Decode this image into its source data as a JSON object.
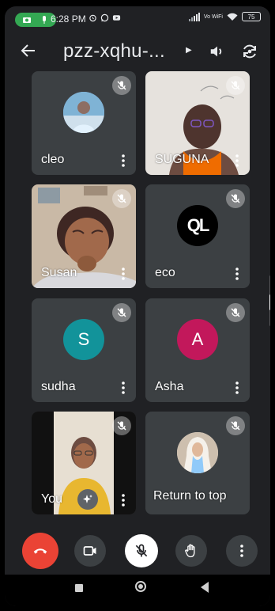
{
  "status_bar": {
    "time": "6:28 PM",
    "network": "Vo WiFi",
    "battery": "75"
  },
  "header": {
    "meeting_code": "pzz-xqhu-..."
  },
  "tiles": [
    {
      "name": "cleo",
      "muted": true,
      "type": "photo-avatar"
    },
    {
      "name": "SUGUNA",
      "muted": true,
      "type": "video"
    },
    {
      "name": "Susan",
      "muted": true,
      "type": "video"
    },
    {
      "name": "eco",
      "muted": true,
      "type": "logo-avatar",
      "logo_text": "QL"
    },
    {
      "name": "sudha",
      "muted": true,
      "type": "letter-avatar",
      "letter": "S",
      "color": "#12939a"
    },
    {
      "name": "Asha",
      "muted": true,
      "type": "letter-avatar",
      "letter": "A",
      "color": "#c2185b"
    },
    {
      "name": "You",
      "muted": true,
      "type": "video"
    },
    {
      "name": "",
      "muted": true,
      "type": "photo-avatar",
      "overlay_label": "Return to top"
    }
  ],
  "colors": {
    "background": "#202124",
    "tile": "#3c4043",
    "end_call": "#ea4335",
    "rec_indicator": "#34a853"
  }
}
